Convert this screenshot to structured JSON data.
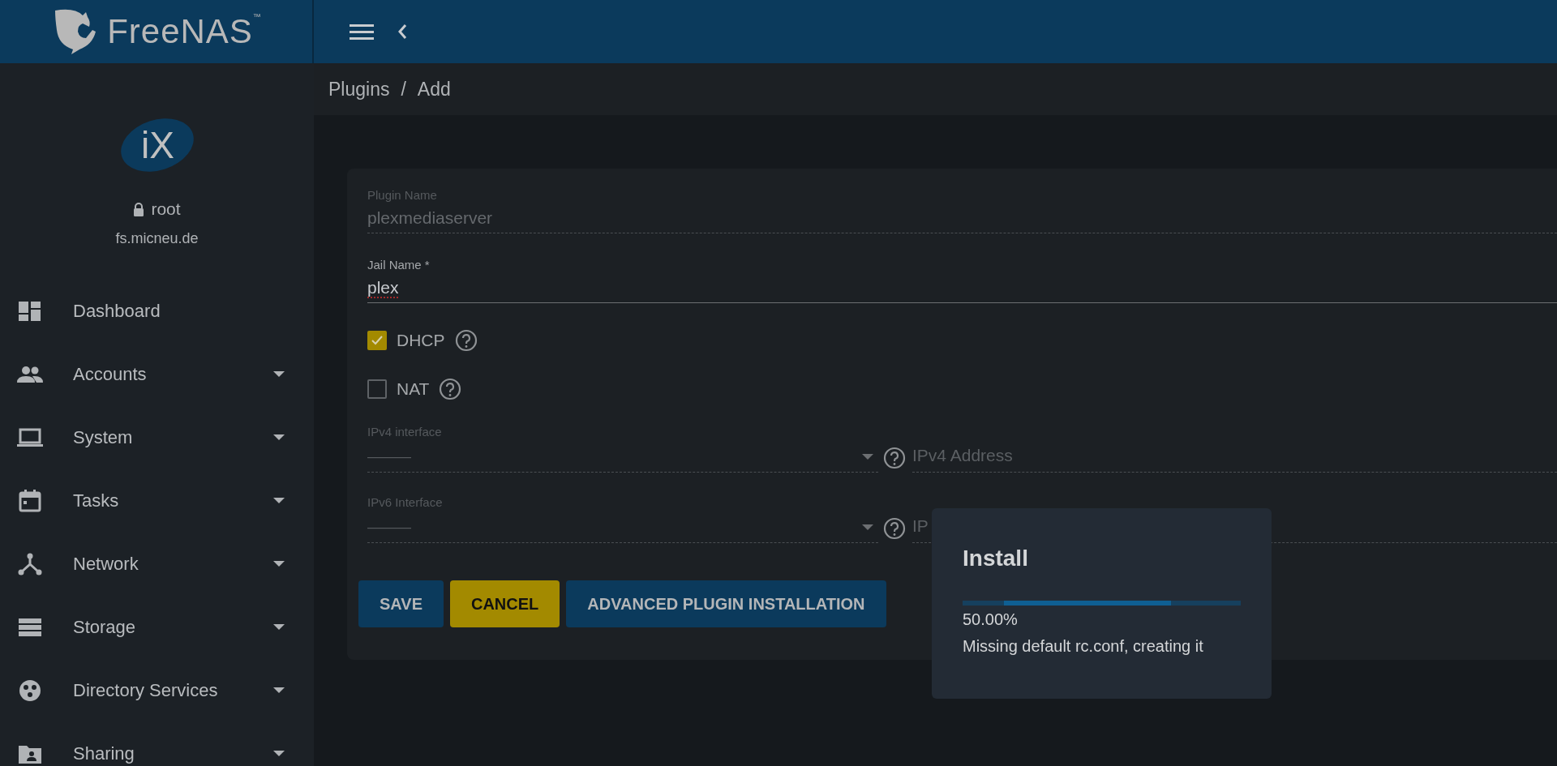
{
  "header": {
    "brand": "FreeNAS",
    "brand_mark": "™"
  },
  "sidebar": {
    "logo_text": "iX",
    "user": "root",
    "host": "fs.micneu.de",
    "items": [
      {
        "label": "Dashboard",
        "has_submenu": false
      },
      {
        "label": "Accounts",
        "has_submenu": true
      },
      {
        "label": "System",
        "has_submenu": true
      },
      {
        "label": "Tasks",
        "has_submenu": true
      },
      {
        "label": "Network",
        "has_submenu": true
      },
      {
        "label": "Storage",
        "has_submenu": true
      },
      {
        "label": "Directory Services",
        "has_submenu": true
      },
      {
        "label": "Sharing",
        "has_submenu": true
      }
    ]
  },
  "breadcrumb": {
    "items": [
      "Plugins",
      "Add"
    ],
    "separator": "/"
  },
  "form": {
    "plugin_name": {
      "label": "Plugin Name",
      "value": "plexmediaserver",
      "disabled": true
    },
    "jail_name": {
      "label": "Jail Name *",
      "value": "plex",
      "disabled": false
    },
    "checkboxes": [
      {
        "label": "DHCP",
        "checked": true
      },
      {
        "label": "NAT",
        "checked": false
      }
    ],
    "ipv4": {
      "interface_label": "IPv4 interface",
      "interface_value": "———",
      "address_placeholder": "IPv4 Address"
    },
    "ipv6": {
      "interface_label": "IPv6 Interface",
      "interface_value": "———",
      "address_placeholder": "IP"
    },
    "buttons": [
      {
        "label": "SAVE",
        "kind": "primary"
      },
      {
        "label": "CANCEL",
        "kind": "accent"
      },
      {
        "label": "ADVANCED PLUGIN INSTALLATION",
        "kind": "primary"
      }
    ]
  },
  "dialog": {
    "title": "Install",
    "progress": {
      "indeterminate": true
    },
    "percent": "50.00%",
    "message": "Missing default rc.conf, creating it"
  }
}
